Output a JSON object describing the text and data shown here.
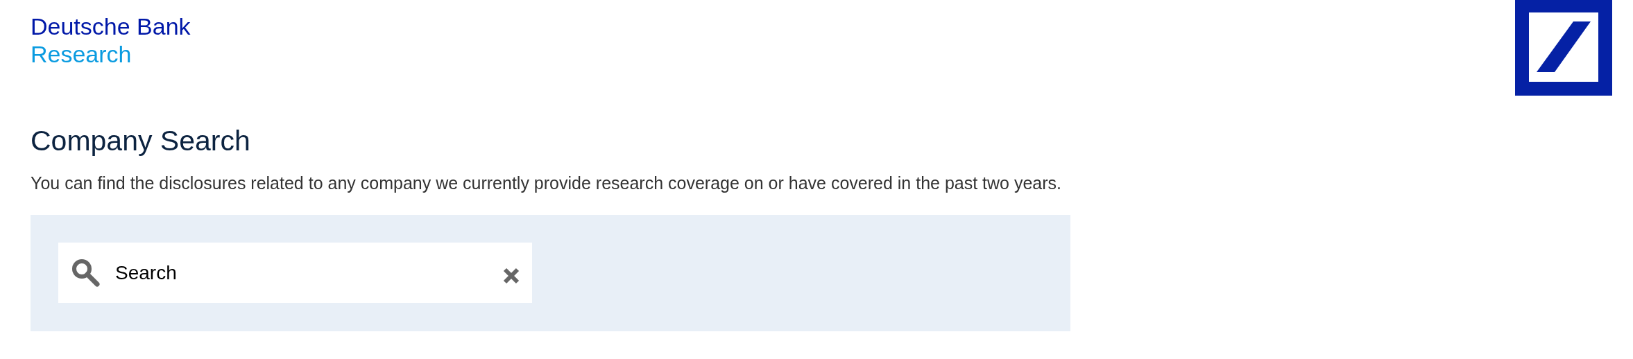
{
  "brand": {
    "name": "Deutsche Bank",
    "subtitle": "Research"
  },
  "heading": "Company Search",
  "description": "You can find the disclosures related to any company we currently provide research coverage on or have covered in the past two years.",
  "search": {
    "value": "Search"
  }
}
